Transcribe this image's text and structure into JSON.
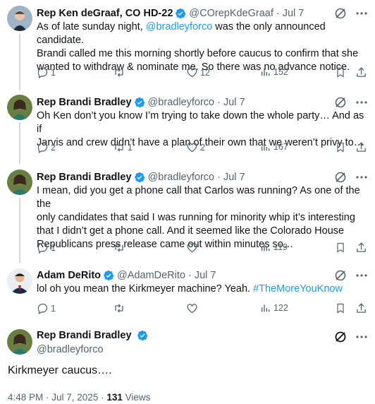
{
  "tweets": [
    {
      "name": "Rep Ken deGraaf, CO HD-22",
      "handle": "@COrepKdeGraaf",
      "date": "Jul 7",
      "text_lines": [
        [
          "As of late sunday night, ",
          "@bradleyforco",
          " was the only announced candidate."
        ],
        "Brandi called me this morning shortly before caucus to confirm that she",
        "wanted to withdraw & nominate me. So there was no advance notice."
      ],
      "replies": "1",
      "retweets": "",
      "likes": "12",
      "views": "152"
    },
    {
      "name": "Rep Brandi Bradley",
      "handle": "@bradleyforco",
      "date": "Jul 7",
      "text_lines": [
        "Oh Ken don’t you know I’m trying to take down the whole party… And as if",
        "Jarvis and crew didn’t have a plan of their own that we weren’t privy to…"
      ],
      "replies": "2",
      "retweets": "1",
      "likes": "2",
      "views": "167"
    },
    {
      "name": "Rep Brandi Bradley",
      "handle": "@bradleyforco",
      "date": "Jul 7",
      "text_lines": [
        "I mean, did you get a phone call that Carlos was running? As one of the the",
        "only candidates that said I was running for minority whip it’s interesting",
        "that I didn’t get a phone call. And it seemed like the Colorado House",
        "Republicans press release came out within minutes so…"
      ],
      "replies": "1",
      "retweets": "",
      "likes": "",
      "views": "119"
    },
    {
      "name": "Adam DeRito",
      "handle": "@AdamDeRito",
      "date": "Jul 7",
      "text_lines": [
        [
          "lol oh you mean the Kirkmeyer machine? Yeah. ",
          "#TheMoreYouKnow",
          ""
        ]
      ],
      "replies": "1",
      "retweets": "",
      "likes": "",
      "views": "122"
    }
  ],
  "main_tweet": {
    "name": "Rep Brandi Bradley",
    "handle": "@bradleyforco",
    "text": "Kirkmeyer caucus….",
    "time": "4:48 PM · Jul 7, 2025 · ",
    "views_count": "131",
    "views_label": " Views"
  },
  "colors": {
    "accent": "#1d9bf0",
    "secondary_text": "#536471",
    "thread_line": "#cfd9de"
  }
}
